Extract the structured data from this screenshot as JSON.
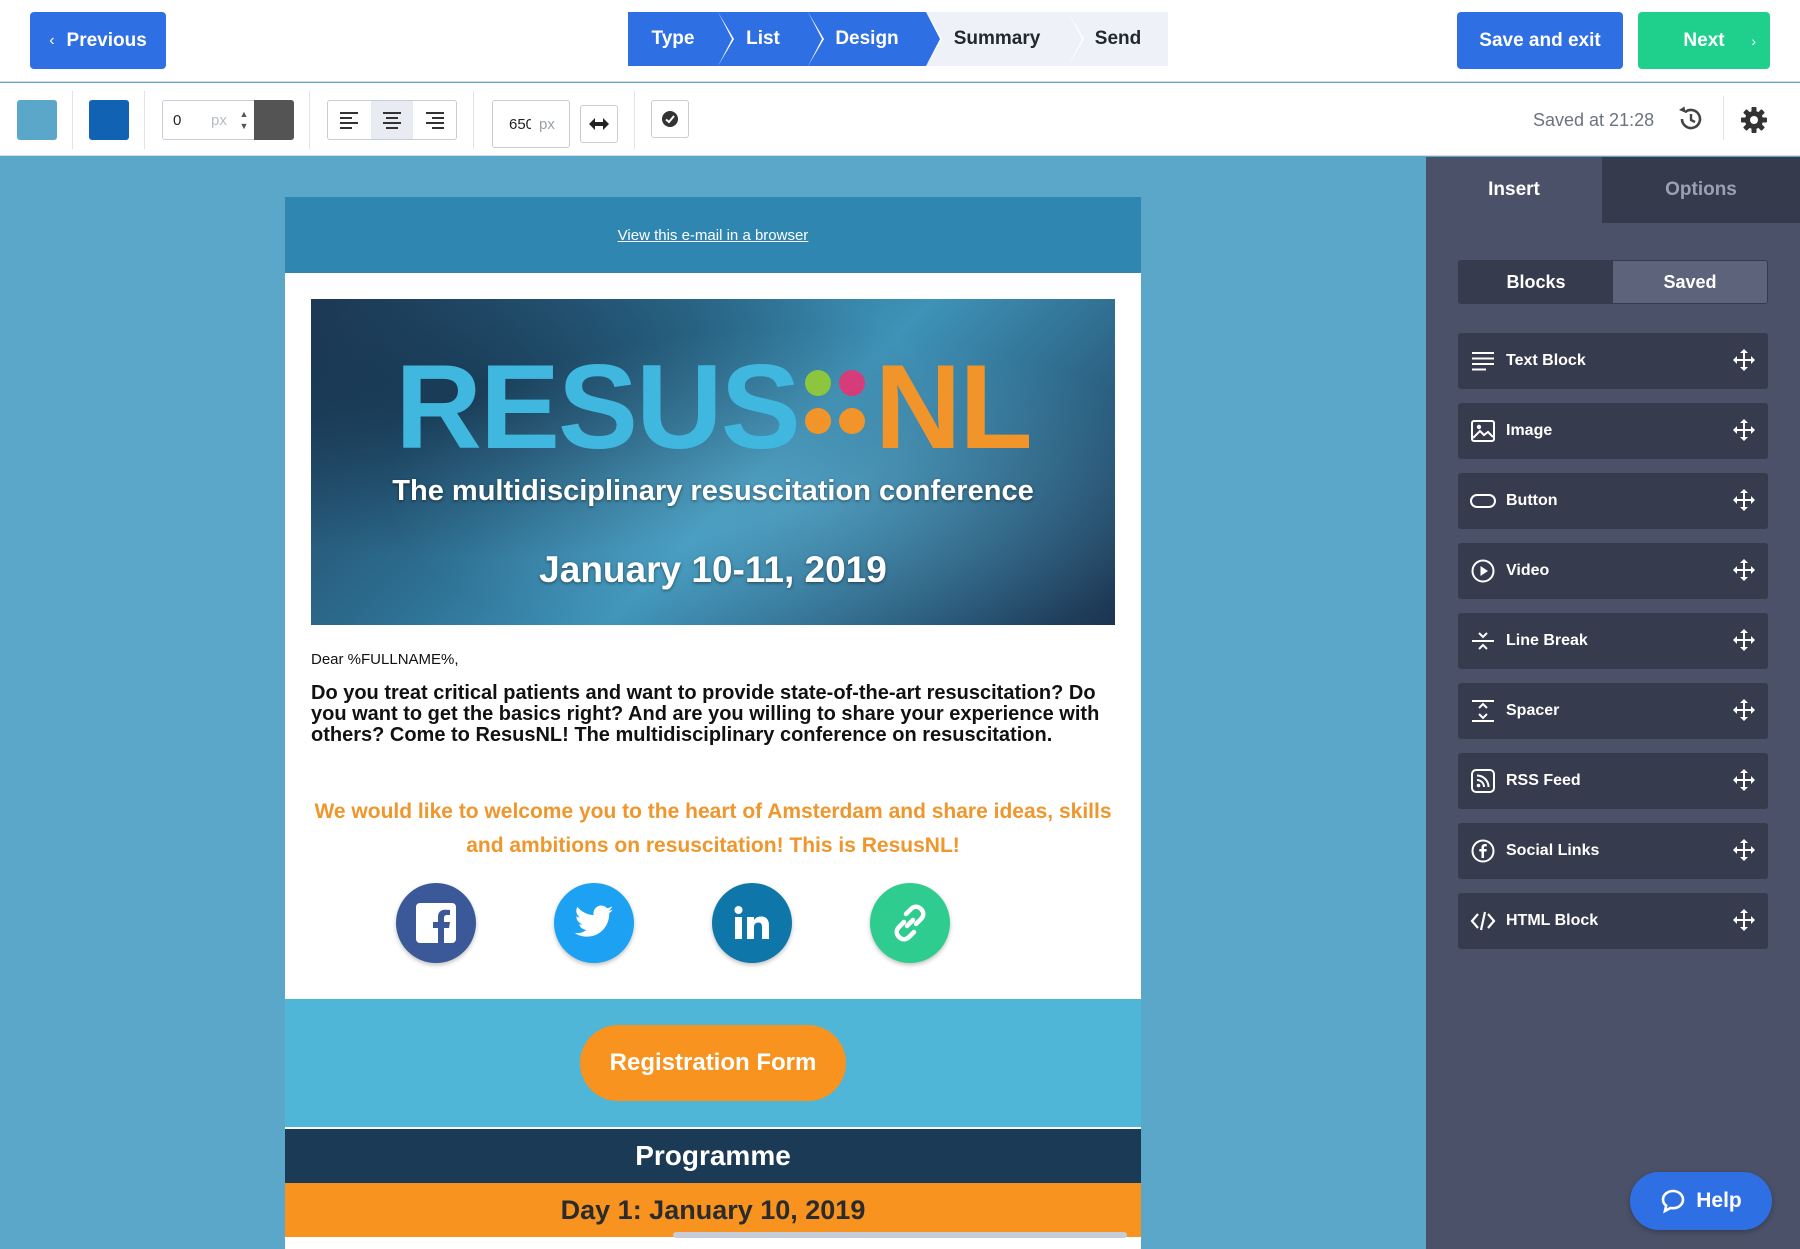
{
  "topbar": {
    "previous_label": "Previous",
    "save_exit_label": "Save and exit",
    "next_label": "Next",
    "steps": [
      {
        "label": "Type",
        "state": "done"
      },
      {
        "label": "List",
        "state": "done"
      },
      {
        "label": "Design",
        "state": "done"
      },
      {
        "label": "Summary",
        "state": "todo"
      },
      {
        "label": "Send",
        "state": "todo"
      }
    ]
  },
  "toolbar": {
    "background_color": "#5aa7c9",
    "content_color": "#1262b3",
    "border_width_value": "0",
    "border_width_unit": "px",
    "border_color": "#545454",
    "email_width_value": "650",
    "email_width_unit": "px",
    "saved_status": "Saved at 21:28",
    "icons": {
      "align_left": "align-left-icon",
      "align_center": "align-center-icon",
      "align_right": "align-right-icon",
      "resize": "arrows-horizontal-icon",
      "check": "check-circle-icon",
      "history": "history-icon",
      "settings": "gear-icon"
    }
  },
  "email": {
    "view_in_browser": "View this e-mail in a browser",
    "banner": {
      "logo_part1": "RESUS",
      "logo_part2": "NL",
      "tagline": "The multidisciplinary resuscitation conference",
      "dates": "January 10-11, 2019"
    },
    "greeting": "Dear %FULLNAME%,",
    "intro": "Do you treat critical patients and want to provide state-of-the-art resuscitation? Do you want to get the basics right? And are you willing to share your experience with others? Come to ResusNL! The multidisciplinary conference on resuscitation.",
    "welcome": "We would like to welcome you to the heart of Amsterdam and share ideas, skills and ambitions on resuscitation! This is ResusNL!",
    "social": [
      {
        "icon": "facebook-icon",
        "color": "#3b5998"
      },
      {
        "icon": "twitter-icon",
        "color": "#1da1f2"
      },
      {
        "icon": "linkedin-icon",
        "color": "#0e76a8"
      },
      {
        "icon": "link-icon",
        "color": "#2ecc8f"
      }
    ],
    "registration_button": "Registration Form",
    "programme_heading": "Programme",
    "day1_heading": "Day 1: January 10, 2019"
  },
  "panel": {
    "tabs": [
      {
        "label": "Insert",
        "active": true
      },
      {
        "label": "Options",
        "active": false
      }
    ],
    "segments": [
      {
        "label": "Blocks",
        "active": true
      },
      {
        "label": "Saved",
        "active": false
      }
    ],
    "blocks": [
      {
        "label": "Text Block",
        "icon": "text-lines-icon"
      },
      {
        "label": "Image",
        "icon": "image-icon"
      },
      {
        "label": "Button",
        "icon": "button-shape-icon"
      },
      {
        "label": "Video",
        "icon": "play-icon"
      },
      {
        "label": "Line Break",
        "icon": "line-break-icon"
      },
      {
        "label": "Spacer",
        "icon": "spacer-icon"
      },
      {
        "label": "RSS Feed",
        "icon": "rss-icon"
      },
      {
        "label": "Social Links",
        "icon": "facebook-circle-icon"
      },
      {
        "label": "HTML Block",
        "icon": "code-icon"
      }
    ]
  },
  "help_label": "Help"
}
